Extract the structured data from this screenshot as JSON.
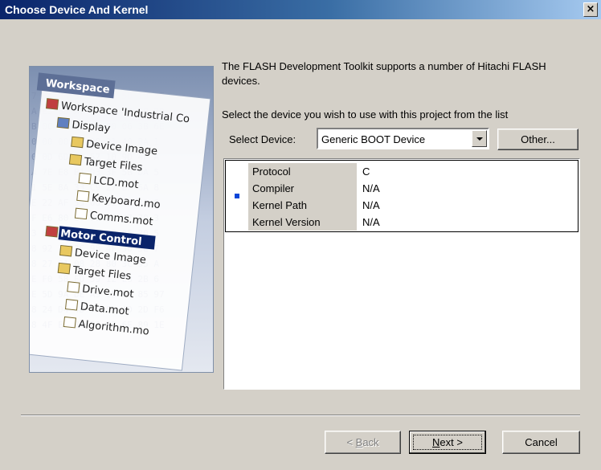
{
  "window": {
    "title": "Choose Device And Kernel",
    "close_glyph": "×"
  },
  "intro_text": "The FLASH Development Toolkit supports a number of Hitachi FLASH devices.",
  "prompt_text": "Select the device you wish to use with this project from the list",
  "device": {
    "label": "Select Device:",
    "selected": "Generic BOOT Device",
    "other_label": "Other..."
  },
  "properties": [
    {
      "key": "Protocol",
      "value": "C"
    },
    {
      "key": "Compiler",
      "value": "N/A"
    },
    {
      "key": "Kernel Path",
      "value": "N/A"
    },
    {
      "key": "Kernel Version",
      "value": "N/A"
    }
  ],
  "buttons": {
    "back_mnemonic": "B",
    "back_rest": "ack",
    "back_prefix": "< ",
    "next_mnemonic": "N",
    "next_rest": "ext >",
    "cancel": "Cancel"
  },
  "illustration": {
    "tab_label": "Workspace",
    "root": "Workspace 'Industrial Co",
    "project1": "Display",
    "p1_items": [
      "Device Image",
      "Target Files",
      "LCD.mot",
      "Keyboard.mo",
      "Comms.mot"
    ],
    "project2": "Motor Control",
    "p2_items": [
      "Device Image",
      "Target Files",
      "Drive.mot",
      "Data.mot",
      "Algorithm.mo"
    ],
    "hex_rows": [
      "7 3A 9A 5E 4B 4D 5D 19 2F",
      "A E3 8D A7 45 E5 67 09 DD",
      "B 0C EC FB 34 70 06 3B 6E",
      "0 00 00 00 00 21 40 BA 1",
      "0 0D 6D F9 57 10 9D 4F A",
      "A 7E E8 B1 D3 3F 5B DA 5",
      "1 5E 8A 33 C9 27 BF 6A 8",
      "E 22 AF 55 00 01 45 31 8",
      "F E6 80 6C 00 31 47 70 3",
      "3 8E 4E 2A 10 82 05 30 5",
      "8 92 1A 2C 98 4F 50 3E 7",
      "8 27 91 08 28 80 3C 95 A",
      "E F0 58 FD 59 12 E8 2B 6",
      "E 5D 9A DE A9 C5 64 85 97",
      "8 24 D4 4D 75 54 AD 2D F6",
      "8 4F EF 84 B0 83 6E 89 1E"
    ]
  }
}
